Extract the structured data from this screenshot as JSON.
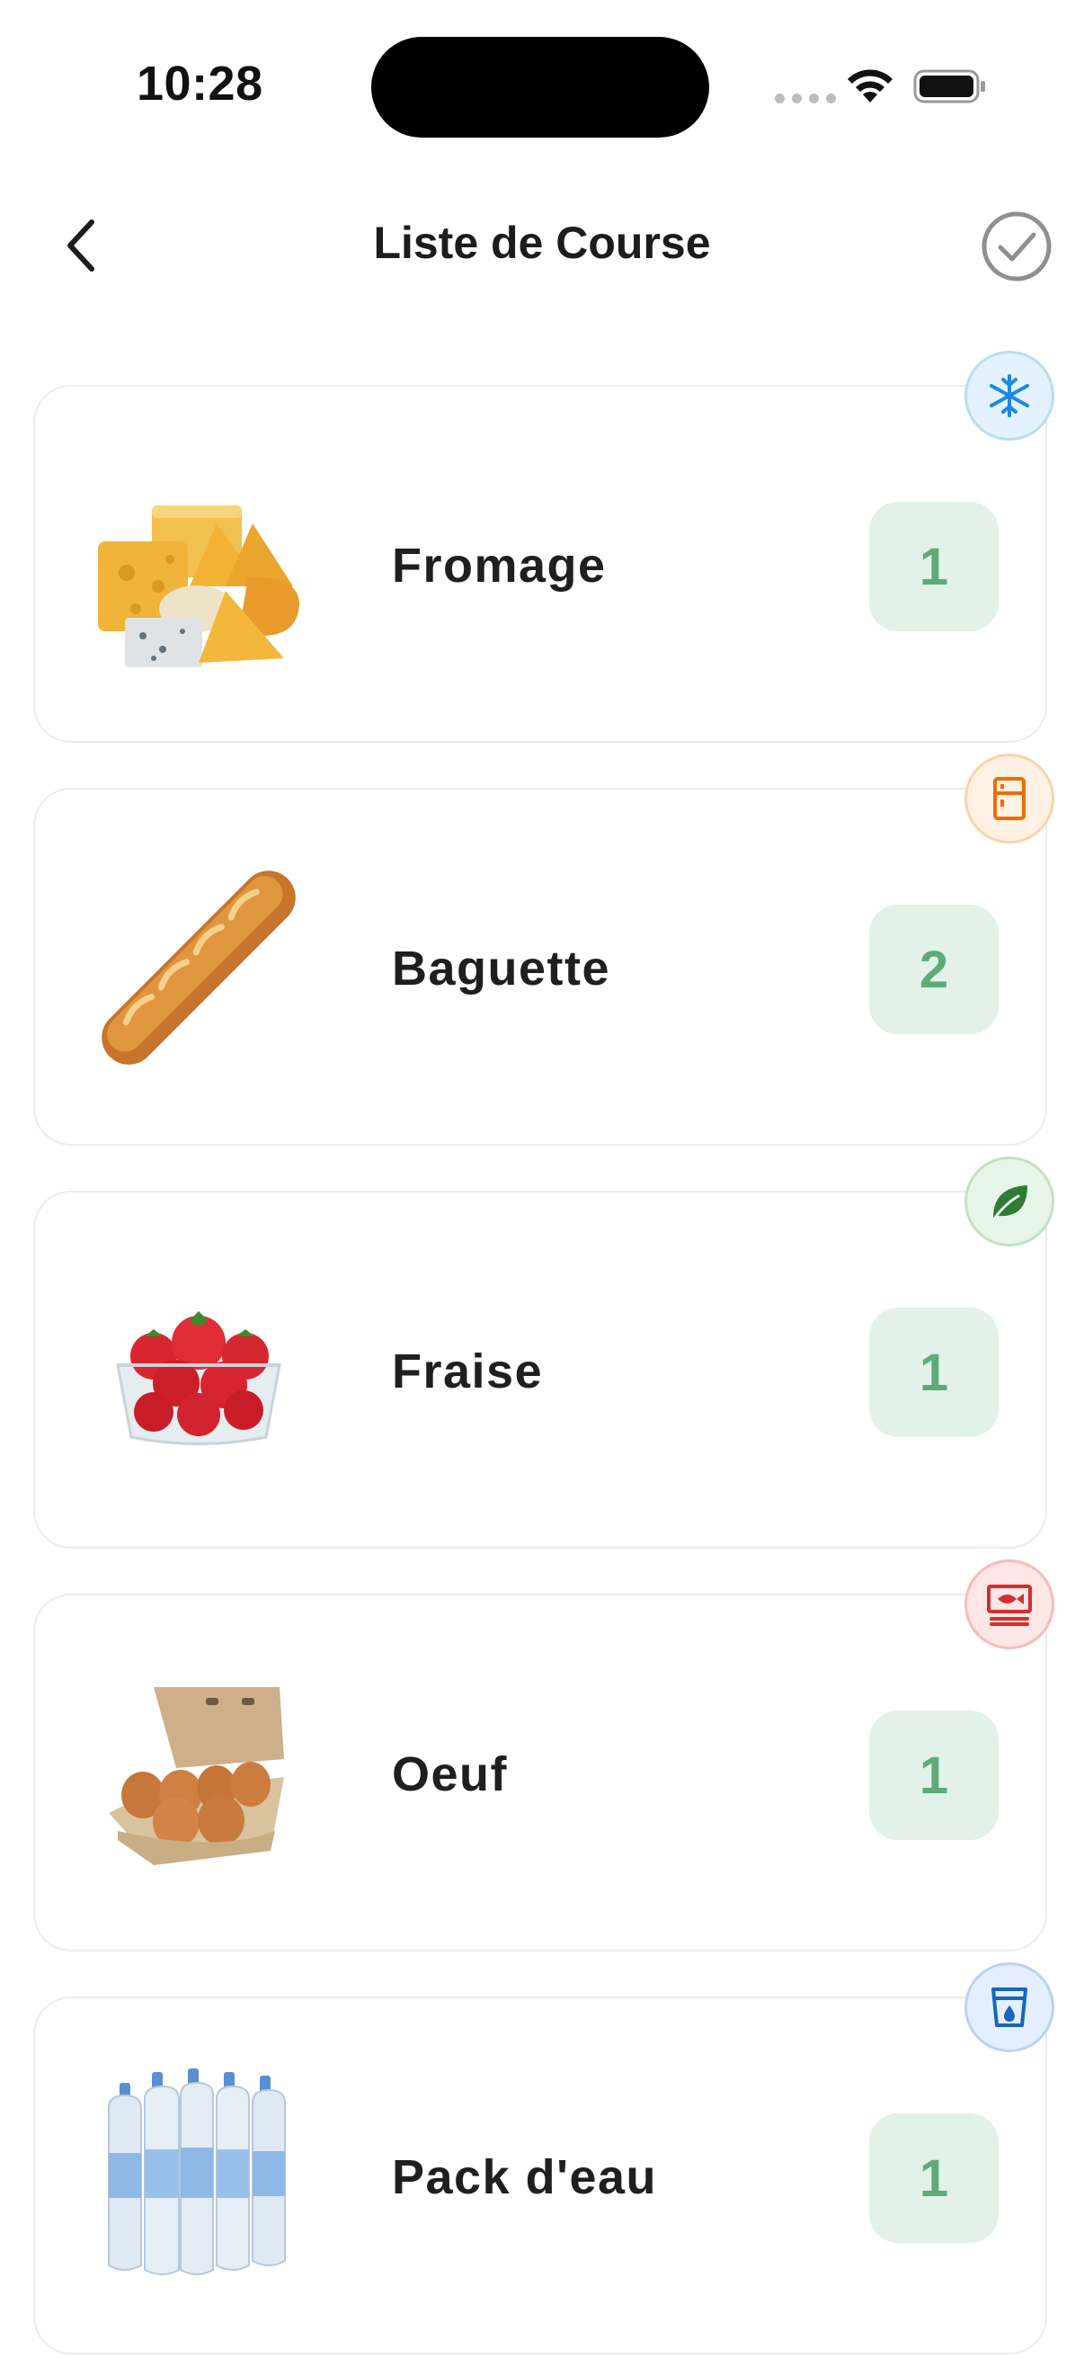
{
  "status_bar": {
    "time": "10:28"
  },
  "header": {
    "title": "Liste de Course"
  },
  "items": [
    {
      "name": "Fromage",
      "quantity": "1",
      "category_icon": "snowflake-icon",
      "badge_color": "#1e88e5",
      "badge_bg": "#e3f2fd"
    },
    {
      "name": "Baguette",
      "quantity": "2",
      "category_icon": "fridge-icon",
      "badge_color": "#ef6c00",
      "badge_bg": "#fff1e3"
    },
    {
      "name": "Fraise",
      "quantity": "1",
      "category_icon": "leaf-icon",
      "badge_color": "#2e7d32",
      "badge_bg": "#e8f5e9"
    },
    {
      "name": "Oeuf",
      "quantity": "1",
      "category_icon": "fish-package-icon",
      "badge_color": "#d32f2f",
      "badge_bg": "#fde6e6"
    },
    {
      "name": "Pack d'eau",
      "quantity": "1",
      "category_icon": "water-cup-icon",
      "badge_color": "#1565c0",
      "badge_bg": "#e3efff"
    }
  ],
  "colors": {
    "quantity_bg": "#e2f2e9",
    "quantity_text": "#5dab7a"
  }
}
